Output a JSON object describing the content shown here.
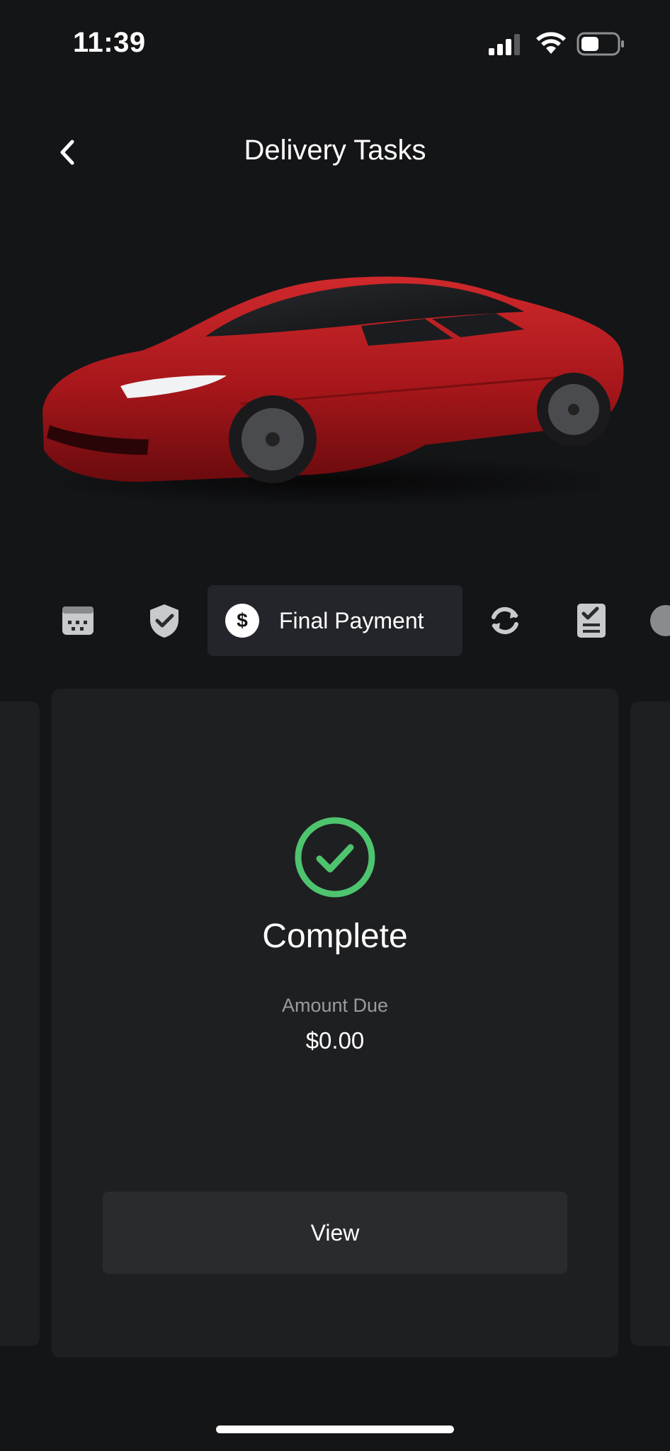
{
  "status_bar": {
    "time": "11:39",
    "icons": [
      "cellular-signal-icon",
      "wifi-icon",
      "battery-icon"
    ]
  },
  "header": {
    "title": "Delivery Tasks",
    "back_icon": "chevron-left-icon"
  },
  "car": {
    "description_icon": "car-image",
    "color": "#b3191d"
  },
  "tabs": [
    {
      "icon": "calendar-icon",
      "active": false
    },
    {
      "icon": "shield-check-icon",
      "active": false
    },
    {
      "icon": "dollar-icon",
      "label": "Final Payment",
      "active": true
    },
    {
      "icon": "refresh-icon",
      "active": false
    },
    {
      "icon": "checklist-icon",
      "active": false
    },
    {
      "icon": "circle-icon",
      "active": false
    }
  ],
  "card": {
    "status": "Complete",
    "status_icon": "check-circle-icon",
    "amount_label": "Amount Due",
    "amount_value": "$0.00",
    "button_label": "View"
  },
  "colors": {
    "background": "#141517",
    "card": "#1e1f21",
    "success": "#4ec46e",
    "car_red": "#b3191d"
  }
}
